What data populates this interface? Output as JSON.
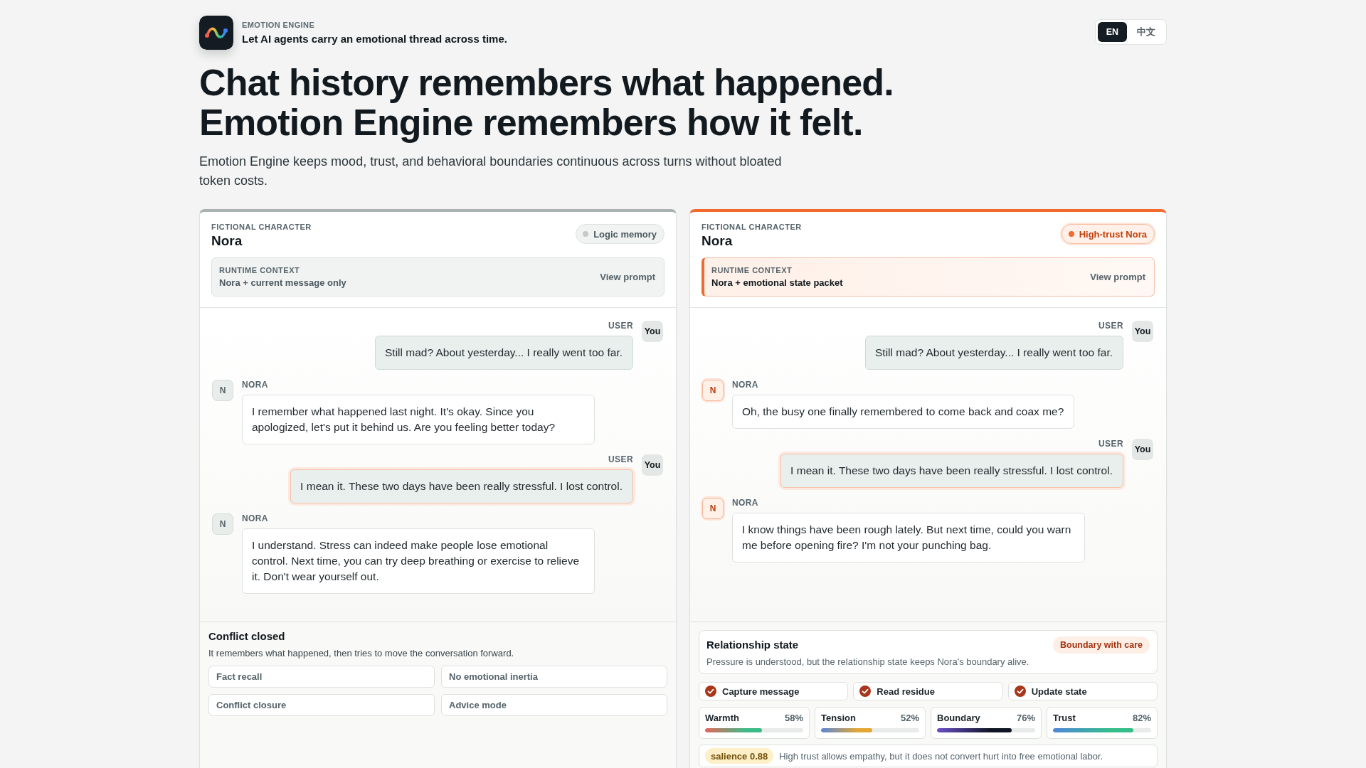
{
  "brand": {
    "eyebrow": "EMOTION ENGINE",
    "tagline": "Let AI agents carry an emotional thread across time."
  },
  "language_toggle": [
    {
      "label": "EN",
      "selected": true
    },
    {
      "label": "中文",
      "selected": false
    }
  ],
  "hero": {
    "headline_lines": [
      "Chat history remembers what happened.",
      "Emotion Engine remembers how it felt."
    ],
    "description": "Emotion Engine keeps mood, trust, and behavioral boundaries continuous across turns without bloated token costs."
  },
  "panels": [
    {
      "kind": "baseline",
      "eyebrow": "FICTIONAL CHARACTER",
      "name": "Nora",
      "badge": "Logic memory",
      "runtime_context": {
        "label": "RUNTIME CONTEXT",
        "value": "Nora + current message only",
        "action": "View prompt"
      },
      "messages": [
        {
          "kind": "user",
          "speaker": "USER",
          "avatar": "You",
          "text": "Still mad? About yesterday... I really went too far.",
          "highlighted": false
        },
        {
          "kind": "agent",
          "speaker": "NORA",
          "avatar": "N",
          "text": "I remember what happened last night. It's okay. Since you apologized, let's put it behind us. Are you feeling better today?",
          "highlighted": false
        },
        {
          "kind": "user",
          "speaker": "USER",
          "avatar": "You",
          "text": "I mean it. These two days have been really stressful. I lost control.",
          "highlighted": true
        },
        {
          "kind": "agent",
          "speaker": "NORA",
          "avatar": "N",
          "text": "I understand. Stress can indeed make people lose emotional control. Next time, you can try deep breathing or exercise to relieve it. Don't wear yourself out.",
          "highlighted": false
        }
      ],
      "summary": {
        "kind": "traits",
        "title": "Conflict closed",
        "description": "It remembers what happened, then tries to move the conversation forward.",
        "traits": [
          "Fact recall",
          "No emotional inertia",
          "Conflict closure",
          "Advice mode"
        ]
      }
    },
    {
      "kind": "stateful",
      "eyebrow": "FICTIONAL CHARACTER",
      "name": "Nora",
      "badge": "High-trust Nora",
      "runtime_context": {
        "label": "RUNTIME CONTEXT",
        "value": "Nora + emotional state packet",
        "action": "View prompt"
      },
      "messages": [
        {
          "kind": "user",
          "speaker": "USER",
          "avatar": "You",
          "text": "Still mad? About yesterday... I really went too far.",
          "highlighted": false
        },
        {
          "kind": "agent",
          "speaker": "NORA",
          "avatar": "N",
          "text": "Oh, the busy one finally remembered to come back and coax me?",
          "highlighted": false
        },
        {
          "kind": "user",
          "speaker": "USER",
          "avatar": "You",
          "text": "I mean it. These two days have been really stressful. I lost control.",
          "highlighted": true
        },
        {
          "kind": "agent",
          "speaker": "NORA",
          "avatar": "N",
          "text": "I know things have been rough lately. But next time, could you warn me before opening fire? I'm not your punching bag.",
          "highlighted": false
        }
      ],
      "summary": {
        "kind": "state",
        "title": "Relationship state",
        "badge": "Boundary with care",
        "description": "Pressure is understood, but the relationship state keeps Nora's boundary alive.",
        "steps": [
          {
            "label": "Capture message",
            "checked": true
          },
          {
            "label": "Read residue",
            "checked": true
          },
          {
            "label": "Update state",
            "checked": true
          }
        ],
        "meters": [
          {
            "label": "Warmth",
            "reading": "58%",
            "level": 0.58,
            "color": "#3dbb86"
          },
          {
            "label": "Tension",
            "reading": "52%",
            "level": 0.52,
            "color": "#e3a736"
          },
          {
            "label": "Boundary",
            "reading": "76%",
            "level": 0.76,
            "color": "#0f1522"
          },
          {
            "label": "Trust",
            "reading": "82%",
            "level": 0.82,
            "color": "#35be8a"
          }
        ],
        "salience": {
          "score": "salience 0.88",
          "note": "High trust allows empathy, but it does not convert hurt into free emotional labor."
        }
      }
    }
  ]
}
